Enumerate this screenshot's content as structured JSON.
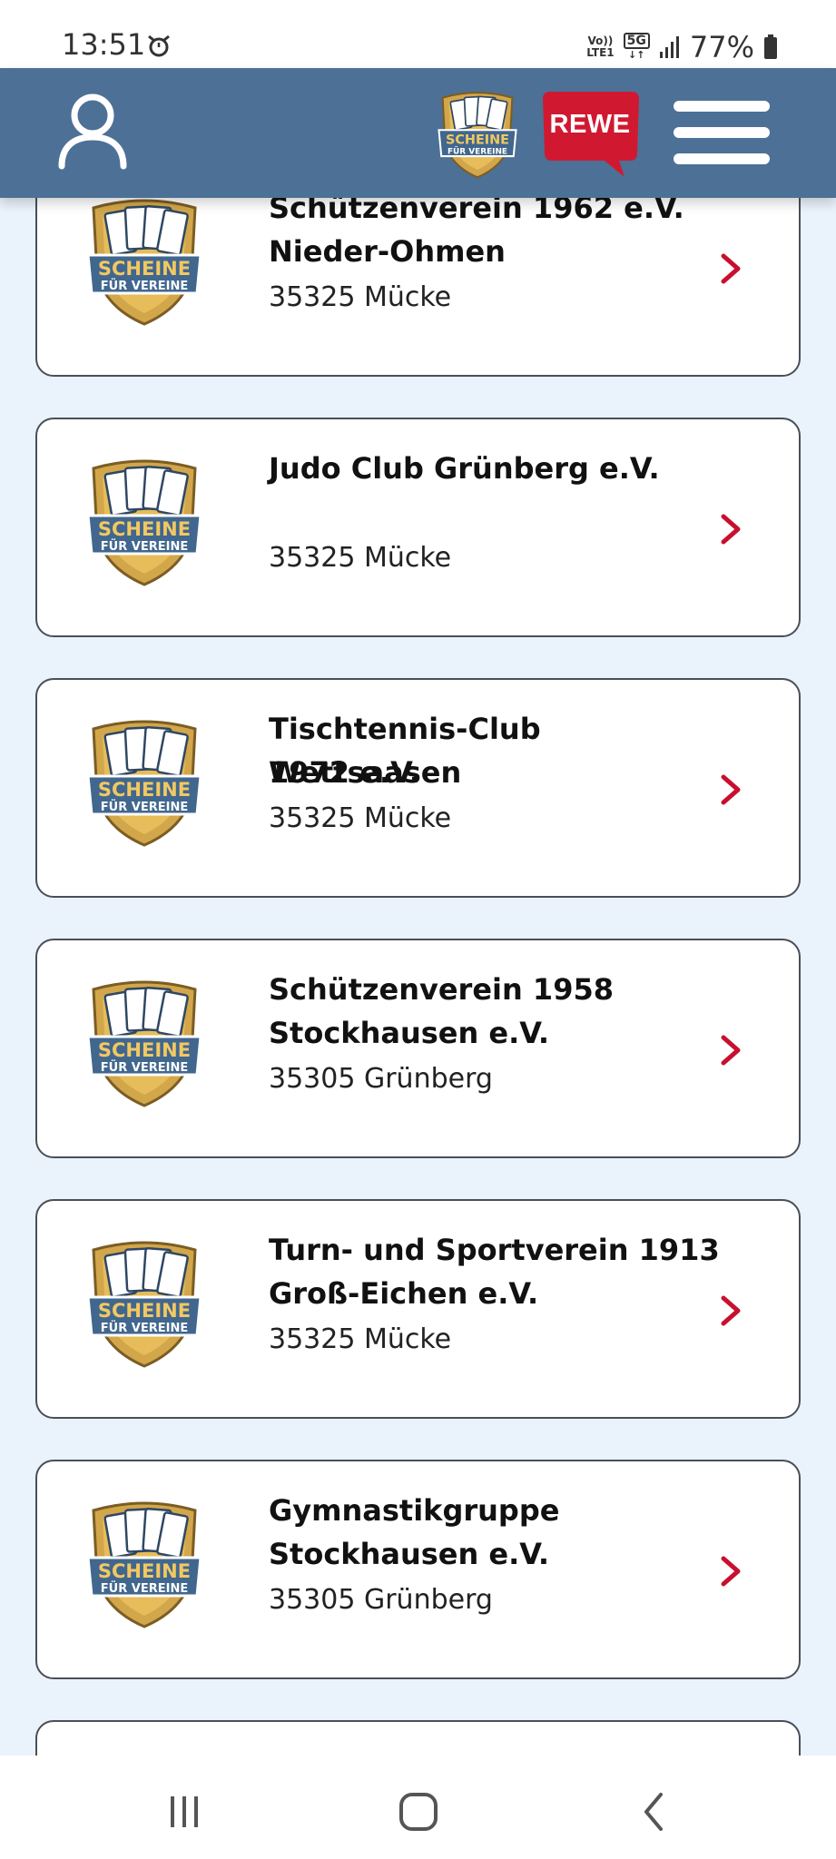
{
  "status_bar": {
    "time": "13:51",
    "volte_label_top": "Vo))",
    "volte_label_bottom": "LTE1",
    "network": "5G",
    "battery": "77%"
  },
  "header": {
    "logo_text_top": "SCHEINE",
    "logo_text_bottom": "FÜR VEREINE",
    "brand": "REWE",
    "brand_color": "#d01931",
    "header_color": "#4d7096"
  },
  "clubs": [
    {
      "name_line1": "Schützenverein 1962 e.V.",
      "name_line2": "Nieder-Ohmen",
      "city": "35325 Mücke"
    },
    {
      "name_line1": "Judo Club Grünberg e.V.",
      "name_line2": "",
      "city": "35325 Mücke"
    },
    {
      "name_line1": "Tischtennis-Club Wettsaasen",
      "name_line2": "1972 e.V.",
      "city": "35325 Mücke"
    },
    {
      "name_line1": "Schützenverein 1958",
      "name_line2": "Stockhausen e.V.",
      "city": "35305 Grünberg"
    },
    {
      "name_line1": "Turn- und Sportverein 1913",
      "name_line2": "Groß-Eichen e.V.",
      "city": "35325 Mücke"
    },
    {
      "name_line1": "Gymnastikgruppe",
      "name_line2": "Stockhausen e.V.",
      "city": "35305 Grünberg"
    }
  ],
  "club_logo": {
    "text_top": "SCHEINE",
    "text_bottom": "FÜR VEREINE"
  },
  "icons": {
    "profile": "user-icon",
    "menu": "hamburger-menu-icon",
    "chevron": "chevron-right-icon",
    "nav_recents": "recent-apps-icon",
    "nav_home": "home-icon",
    "nav_back": "back-icon"
  }
}
